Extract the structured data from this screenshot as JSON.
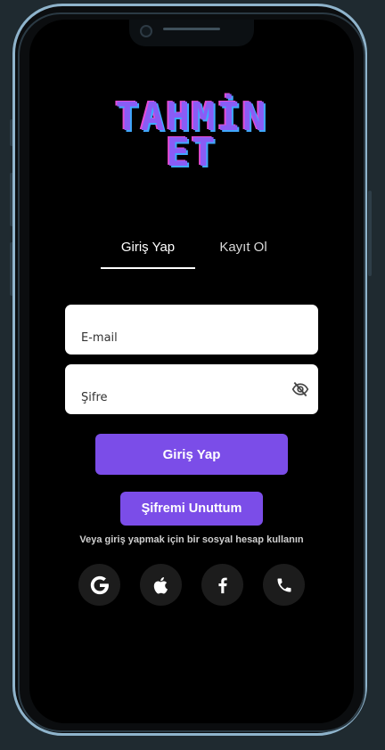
{
  "app": {
    "logo_line1": "TAHMİN",
    "logo_line2": "ET"
  },
  "tabs": [
    {
      "label": "Giriş Yap",
      "active": true
    },
    {
      "label": "Kayıt Ol",
      "active": false
    }
  ],
  "form": {
    "email_placeholder": "E-mail",
    "email_value": "",
    "password_placeholder": "Şifre",
    "password_value": "",
    "password_toggle_icon": "eye-off-icon"
  },
  "actions": {
    "login_label": "Giriş Yap",
    "forgot_label": "Şifremi Unuttum"
  },
  "social": {
    "caption": "Veya giriş yapmak için bir sosyal hesap kullanın",
    "providers": [
      {
        "icon": "google-icon"
      },
      {
        "icon": "apple-icon"
      },
      {
        "icon": "facebook-icon"
      },
      {
        "icon": "phone-icon"
      }
    ]
  },
  "colors": {
    "accent": "#7b4de8",
    "screen_bg": "#000000",
    "frame": "#8fb4cc",
    "social_btn_bg": "#1c1c1c"
  }
}
